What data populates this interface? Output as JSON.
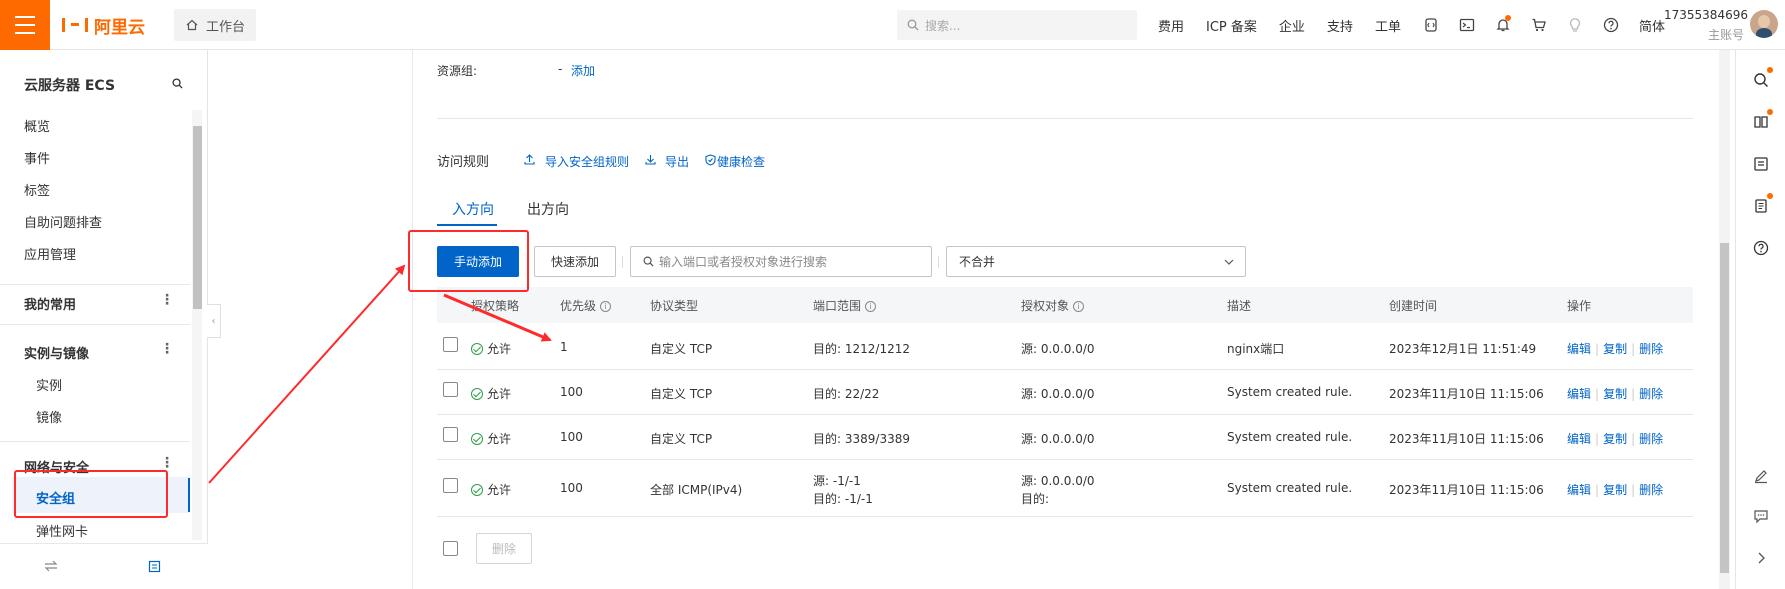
{
  "topbar": {
    "logo_text": "阿里云",
    "workbench": "工作台",
    "search_placeholder": "搜索...",
    "nav": [
      "费用",
      "ICP 备案",
      "企业",
      "支持",
      "工单"
    ],
    "lang": "简体",
    "user_id": "17355384696",
    "user_role": "主账号",
    "icons": [
      "code-icon",
      "terminal-icon",
      "bell-icon",
      "cart-icon",
      "bulb-icon",
      "help-icon"
    ]
  },
  "sidebar": {
    "title": "云服务器 ECS",
    "items": [
      "概览",
      "事件",
      "标签",
      "自助问题排查",
      "应用管理"
    ],
    "group_favorites": "我的常用",
    "group_instances": "实例与镜像",
    "instances_items": [
      "实例",
      "镜像"
    ],
    "group_network": "网络与安全",
    "network_items": [
      "安全组",
      "弹性网卡"
    ]
  },
  "content": {
    "resource_group_label": "资源组:",
    "resource_group_value": "-",
    "resource_group_add": "添加",
    "rules_title": "访问规则",
    "import_link": "导入安全组规则",
    "export_link": "导出",
    "health_link": "健康检查",
    "tabs": [
      "入方向",
      "出方向"
    ],
    "btn_manual_add": "手动添加",
    "btn_quick_add": "快速添加",
    "search_placeholder": "输入端口或者授权对象进行搜索",
    "select_value": "不合并",
    "btn_delete": "删除"
  },
  "table": {
    "headers": [
      "授权策略",
      "优先级",
      "协议类型",
      "端口范围",
      "授权对象",
      "描述",
      "创建时间",
      "操作"
    ],
    "rows": [
      {
        "policy": "允许",
        "priority": "1",
        "protocol": "自定义 TCP",
        "port": "目的: 1212/1212",
        "port2": "",
        "source": "源: 0.0.0.0/0",
        "source2": "",
        "desc": "nginx端口",
        "created": "2023年12月1日 11:51:49"
      },
      {
        "policy": "允许",
        "priority": "100",
        "protocol": "自定义 TCP",
        "port": "目的: 22/22",
        "port2": "",
        "source": "源: 0.0.0.0/0",
        "source2": "",
        "desc": "System created rule.",
        "created": "2023年11月10日 11:15:06"
      },
      {
        "policy": "允许",
        "priority": "100",
        "protocol": "自定义 TCP",
        "port": "目的: 3389/3389",
        "port2": "",
        "source": "源: 0.0.0.0/0",
        "source2": "",
        "desc": "System created rule.",
        "created": "2023年11月10日 11:15:06"
      },
      {
        "policy": "允许",
        "priority": "100",
        "protocol": "全部 ICMP(IPv4)",
        "port": "源: -1/-1",
        "port2": "目的: -1/-1",
        "source": "源: 0.0.0.0/0",
        "source2": "目的:",
        "desc": "System created rule.",
        "created": "2023年11月10日 11:15:06"
      }
    ],
    "ops": [
      "编辑",
      "复制",
      "删除"
    ]
  },
  "colors": {
    "brand": "#ff6a00",
    "primary": "#0064c8",
    "annotation": "#ff2a2a"
  }
}
